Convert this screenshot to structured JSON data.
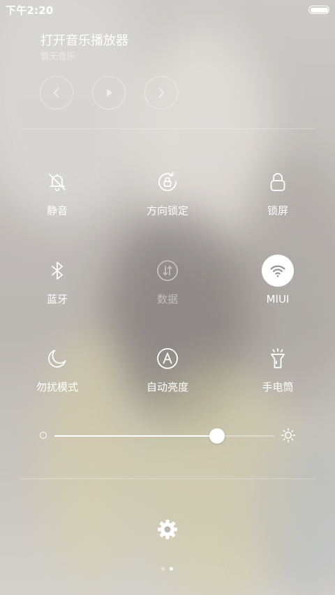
{
  "status_bar": {
    "time": "下午2:20",
    "battery_level": 1.0
  },
  "music": {
    "title": "打开音乐播放器",
    "subtitle": "暂无音乐",
    "controls": [
      "previous-icon",
      "play-icon",
      "next-icon"
    ]
  },
  "toggles": [
    {
      "id": "mute",
      "label": "静音",
      "icon": "bell-off-icon",
      "state": "off"
    },
    {
      "id": "rotation-lock",
      "label": "方向锁定",
      "icon": "rotation-lock-icon",
      "state": "off"
    },
    {
      "id": "lock-screen",
      "label": "锁屏",
      "icon": "lock-icon",
      "state": "off"
    },
    {
      "id": "bluetooth",
      "label": "蓝牙",
      "icon": "bluetooth-icon",
      "state": "off"
    },
    {
      "id": "mobile-data",
      "label": "数据",
      "icon": "data-arrows-icon",
      "state": "disabled"
    },
    {
      "id": "wifi",
      "label": "MIUI",
      "icon": "wifi-icon",
      "state": "on"
    },
    {
      "id": "do-not-disturb",
      "label": "勿扰模式",
      "icon": "moon-icon",
      "state": "off"
    },
    {
      "id": "auto-brightness",
      "label": "自动亮度",
      "icon": "auto-brightness-icon",
      "state": "off"
    },
    {
      "id": "flashlight",
      "label": "手电筒",
      "icon": "flashlight-icon",
      "state": "off"
    }
  ],
  "brightness": {
    "level": 0.74,
    "min_icon": "brightness-low-icon",
    "max_icon": "brightness-high-icon"
  },
  "settings": {
    "icon": "gear-icon"
  },
  "pager": {
    "count": 2,
    "active_index": 1
  },
  "colors": {
    "foreground": "#ffffff",
    "active_toggle_bg": "#ffffff",
    "active_toggle_icon": "#9b9590"
  }
}
